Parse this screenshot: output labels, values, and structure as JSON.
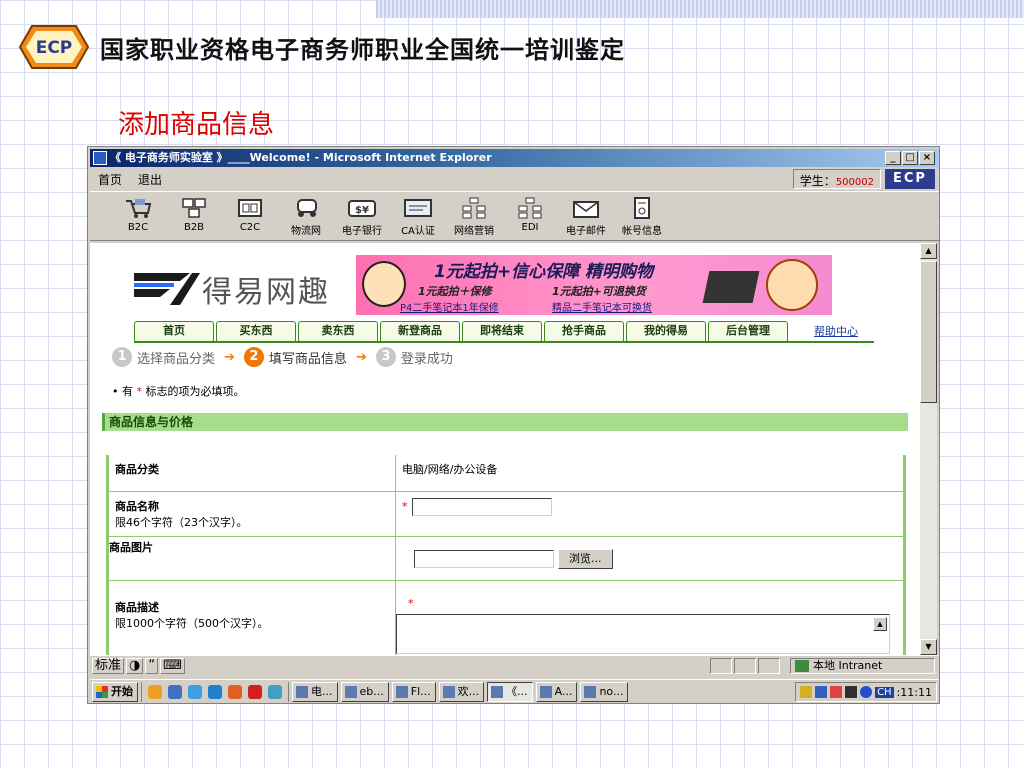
{
  "slide": {
    "title": "国家职业资格电子商务师职业全国统一培训鉴定",
    "subtitle": "添加商品信息",
    "logo_text": "ECP"
  },
  "window": {
    "title": "《 电子商务师实验室 》____Welcome! - Microsoft Internet Explorer",
    "buttons": [
      "_",
      "□",
      "×"
    ]
  },
  "menubar": {
    "items": [
      "首页",
      "退出"
    ],
    "student_label": "学生：",
    "student_id": "500002",
    "brand": "ECP"
  },
  "toolbar": {
    "items": [
      {
        "label": "B2C",
        "icon": "cart-icon"
      },
      {
        "label": "B2B",
        "icon": "b2b-icon"
      },
      {
        "label": "C2C",
        "icon": "c2c-icon"
      },
      {
        "label": "物流网",
        "icon": "truck-icon"
      },
      {
        "label": "电子银行",
        "icon": "bank-icon"
      },
      {
        "label": "CA认证",
        "icon": "certificate-icon"
      },
      {
        "label": "网络营销",
        "icon": "network-icon"
      },
      {
        "label": "EDI",
        "icon": "edi-icon"
      },
      {
        "label": "电子邮件",
        "icon": "mail-icon"
      },
      {
        "label": "帐号信息",
        "icon": "help-icon"
      }
    ]
  },
  "site": {
    "logo_name": "得易网趣",
    "banner": {
      "headline": "1元起拍+信心保障 精明购物",
      "line1": "1元起拍＋保修",
      "line2": "1元起拍+可退换货",
      "link1": "P4二手笔记本1年保修",
      "link2": "精品二手笔记本可换货"
    },
    "nav": [
      "首页",
      "买东西",
      "卖东西",
      "新登商品",
      "即将结束",
      "抢手商品",
      "我的得易",
      "后台管理"
    ],
    "help": "帮助中心",
    "steps": [
      {
        "num": "1",
        "label": "选择商品分类"
      },
      {
        "num": "2",
        "label": "填写商品信息"
      },
      {
        "num": "3",
        "label": "登录成功"
      }
    ],
    "note_prefix": "• 有",
    "note_star": "*",
    "note_suffix": "标志的项为必填项。",
    "section": "商品信息与价格",
    "form": {
      "category_label": "商品分类",
      "category_value": "电脑/网络/办公设备",
      "name_label": "商品名称",
      "name_hint": "限46个字符（23个汉字）。",
      "image_label": "商品图片",
      "browse": "浏览...",
      "desc_label": "商品描述",
      "desc_hint": "限1000个字符（500个汉字）。",
      "star": "*"
    }
  },
  "statusbar": {
    "ime_label": "标准",
    "zone": "本地 Intranet"
  },
  "taskbar": {
    "start": "开始",
    "tasks": [
      "电...",
      "eb...",
      "Fl...",
      "欢...",
      "《...",
      "A...",
      "no..."
    ],
    "ime": "CH",
    "clock": ":11:11"
  }
}
